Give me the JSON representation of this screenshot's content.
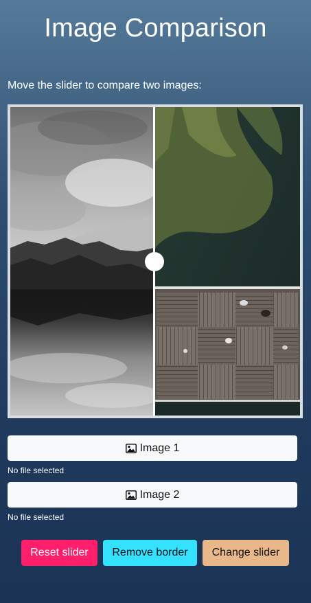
{
  "page": {
    "title": "Image Comparison",
    "instructions": "Move the slider to compare two images:"
  },
  "comparison": {
    "left_image": "black-and-white mountain lake with reflection",
    "right_image": "aerial view of boardwalk pier over dark water",
    "slider_position": 0.5
  },
  "uploads": [
    {
      "label": "Image 1",
      "icon": "image-icon",
      "status": "No file selected"
    },
    {
      "label": "Image 2",
      "icon": "image-icon",
      "status": "No file selected"
    }
  ],
  "actions": {
    "reset_label": "Reset slider",
    "remove_border_label": "Remove border",
    "change_slider_label": "Change slider"
  },
  "colors": {
    "reset": "#ff1f6b",
    "remove_border": "#34e1ff",
    "change_slider": "#e8b88b",
    "file_button": "#f8f9fa"
  }
}
